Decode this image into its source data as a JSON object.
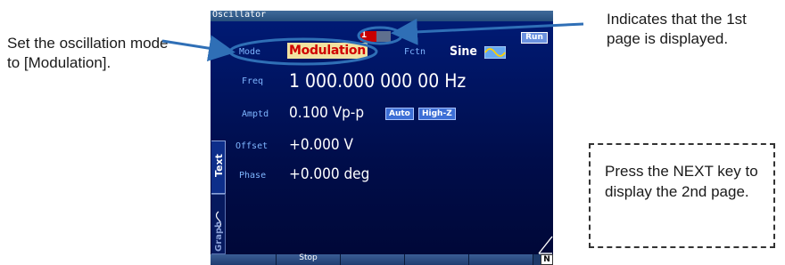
{
  "callouts": {
    "mode": "Set the oscillation mode to [Modulation].",
    "page": "Indicates that the 1st page is displayed.",
    "next": "Press the NEXT key to display the 2nd page."
  },
  "screen": {
    "window_title": "Oscillator",
    "run_status": "Run",
    "page_indicator": "1",
    "mode_label": "Mode",
    "mode_value": "Modulation",
    "fctn_label": "Fctn",
    "fctn_value": "Sine",
    "freq_label": "Freq",
    "freq_value": "1 000.000 000 00 Hz",
    "amptd_label": "Amptd",
    "amptd_value": "0.100 Vp-p",
    "amptd_badges": [
      "Auto",
      "High-Z"
    ],
    "offset_label": "Offset",
    "offset_value": "+0.000 V",
    "phase_label": "Phase",
    "phase_value": "+0.000 deg",
    "side_tabs": {
      "text": "Text",
      "graph": "Graph"
    },
    "softkeys": [
      "",
      "Stop",
      "",
      "",
      "",
      ""
    ],
    "next_indicator": "N"
  },
  "colors": {
    "screen_bg": "#001a74",
    "highlight_blue": "#2f6fb6",
    "mode_text": "#d00000",
    "mode_bg": "#f2e2a0",
    "label_blue": "#7fb6ff"
  },
  "icons": [
    "sine-wave-icon",
    "next-indicator-icon",
    "callout-arrow"
  ]
}
